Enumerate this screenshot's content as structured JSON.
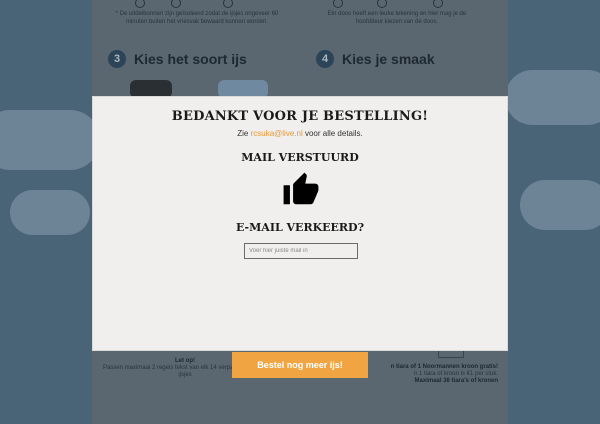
{
  "background": {
    "step_left_text": "* De uitdelbonnen zijn geïsoleerd zodat de ijsjes ongeveer 60 minuten buiten het vriesvak bewaard kunnen worden.",
    "step_right_text": "Ein doos heeft een leuke tekening en hier mag je de hoofddeur kiezen van de doos.",
    "step3": {
      "number": "3",
      "title": "Kies het soort ijs"
    },
    "step4": {
      "number": "4",
      "title": "Kies je smaak"
    },
    "bottom_left_title": "Let op!",
    "bottom_left_text": "Passen maximaal 2 regels tekst van elk 14 verpakking van de ijsjes",
    "bottom_right_line1": "n tiara of 1 Noormannen kroon gratis!",
    "bottom_right_line2": "n 1 tiara of kroon is €1 per stuk.",
    "bottom_right_line3": "Maximaal 36 tiara's of kronen",
    "order_button": "Bestel nog meer ijs!"
  },
  "modal": {
    "title": "BEDANKT VOOR JE BESTELLING!",
    "sub_prefix": "Zie",
    "email": "rcsuka@live.nl",
    "sub_suffix": "voor alle details.",
    "mail_sent": "MAIL VERSTUURD",
    "wrong_email": "E-MAIL VERKEERD?",
    "input_placeholder": "Voer hier juiste mail in",
    "input_value": ""
  },
  "colors": {
    "accent": "#f0a542",
    "email_link": "#e8983a",
    "modal_bg": "#f0efed",
    "step_circle": "#2c4458"
  },
  "icons": {
    "thumbs_up": "thumbs-up-icon"
  }
}
